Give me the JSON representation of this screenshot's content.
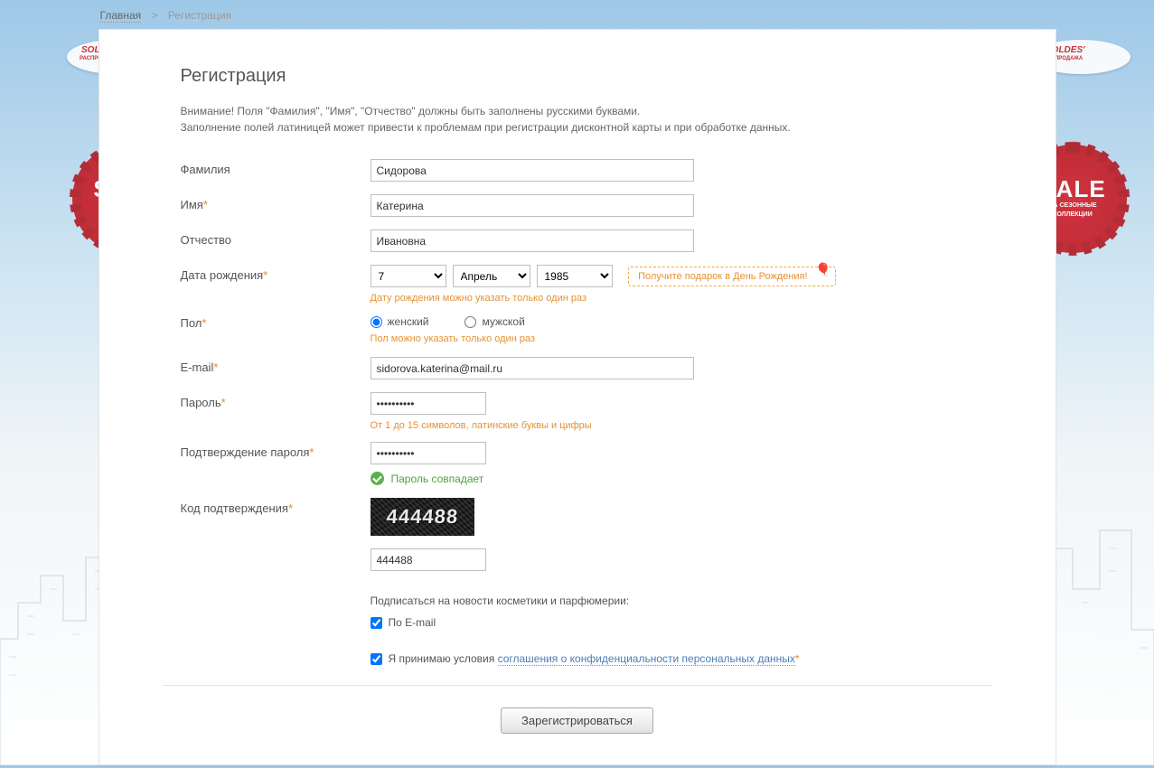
{
  "breadcrumb": {
    "home": "Главная",
    "current": "Регистрация"
  },
  "title": "Регистрация",
  "warning_line1": "Внимание! Поля \"Фамилия\", \"Имя\", \"Отчество\" должны быть заполнены русскими буквами.",
  "warning_line2": "Заполнение полей латиницей может привести к проблемам при регистрации дисконтной карты и при обработке данных.",
  "labels": {
    "lastname": "Фамилия",
    "firstname": "Имя",
    "middlename": "Отчество",
    "birthdate": "Дата рождения",
    "gender": "Пол",
    "email": "E-mail",
    "password": "Пароль",
    "password_confirm": "Подтверждение пароля",
    "captcha": "Код подтверждения"
  },
  "values": {
    "lastname": "Сидорова",
    "firstname": "Катерина",
    "middlename": "Ивановна",
    "day": "7",
    "month": "Апрель",
    "year": "1985",
    "email": "sidorova.katerina@mail.ru",
    "password": "••••••••••",
    "password_confirm": "••••••••••",
    "captcha_code": "444488",
    "captcha_display": "444488"
  },
  "gift_text": "Получите подарок в День Рождения!",
  "hints": {
    "birthdate": "Дату рождения можно указать только один раз",
    "gender": "Пол можно указать только один раз",
    "password": "От 1 до 15 символов, латинские буквы и цифры"
  },
  "gender": {
    "female": "женский",
    "male": "мужской",
    "selected": "female"
  },
  "password_match": "Пароль совпадает",
  "subscribe": {
    "heading": "Подписаться на новости косметики и парфюмерии:",
    "email": "По E-mail"
  },
  "agreement": {
    "prefix": "Я принимаю условия ",
    "link": "соглашения о конфиденциальности персональных данных"
  },
  "submit": "Зарегистрироваться",
  "decor": {
    "soldes": "SOLDES'",
    "soldes_sub": "РАСПРОДАЖА",
    "sale": "SALE",
    "sale_sub1": "НА СЕЗОННЫЕ",
    "sale_sub2": "КОЛЛЕКЦИИ"
  }
}
